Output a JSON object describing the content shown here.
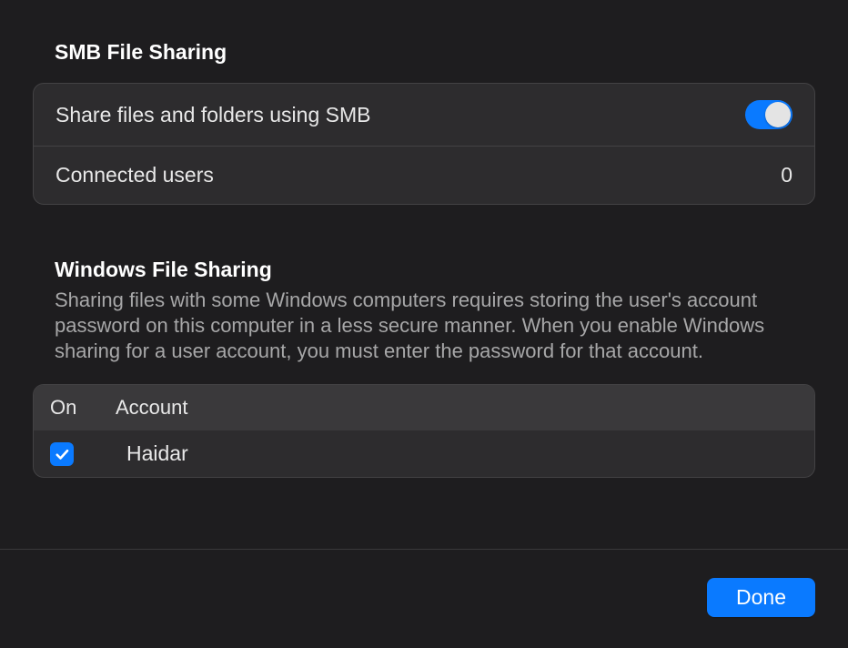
{
  "smb": {
    "title": "SMB File Sharing",
    "share_label": "Share files and folders using SMB",
    "share_enabled": true,
    "connected_label": "Connected users",
    "connected_count": "0"
  },
  "windows": {
    "title": "Windows File Sharing",
    "description": "Sharing files with some Windows computers requires storing the user's account password on this computer in a less secure manner. When you enable Windows sharing for a user account, you must enter the password for that account.",
    "columns": {
      "on": "On",
      "account": "Account"
    },
    "accounts": [
      {
        "enabled": true,
        "name": "Haidar"
      }
    ]
  },
  "footer": {
    "done_label": "Done"
  }
}
